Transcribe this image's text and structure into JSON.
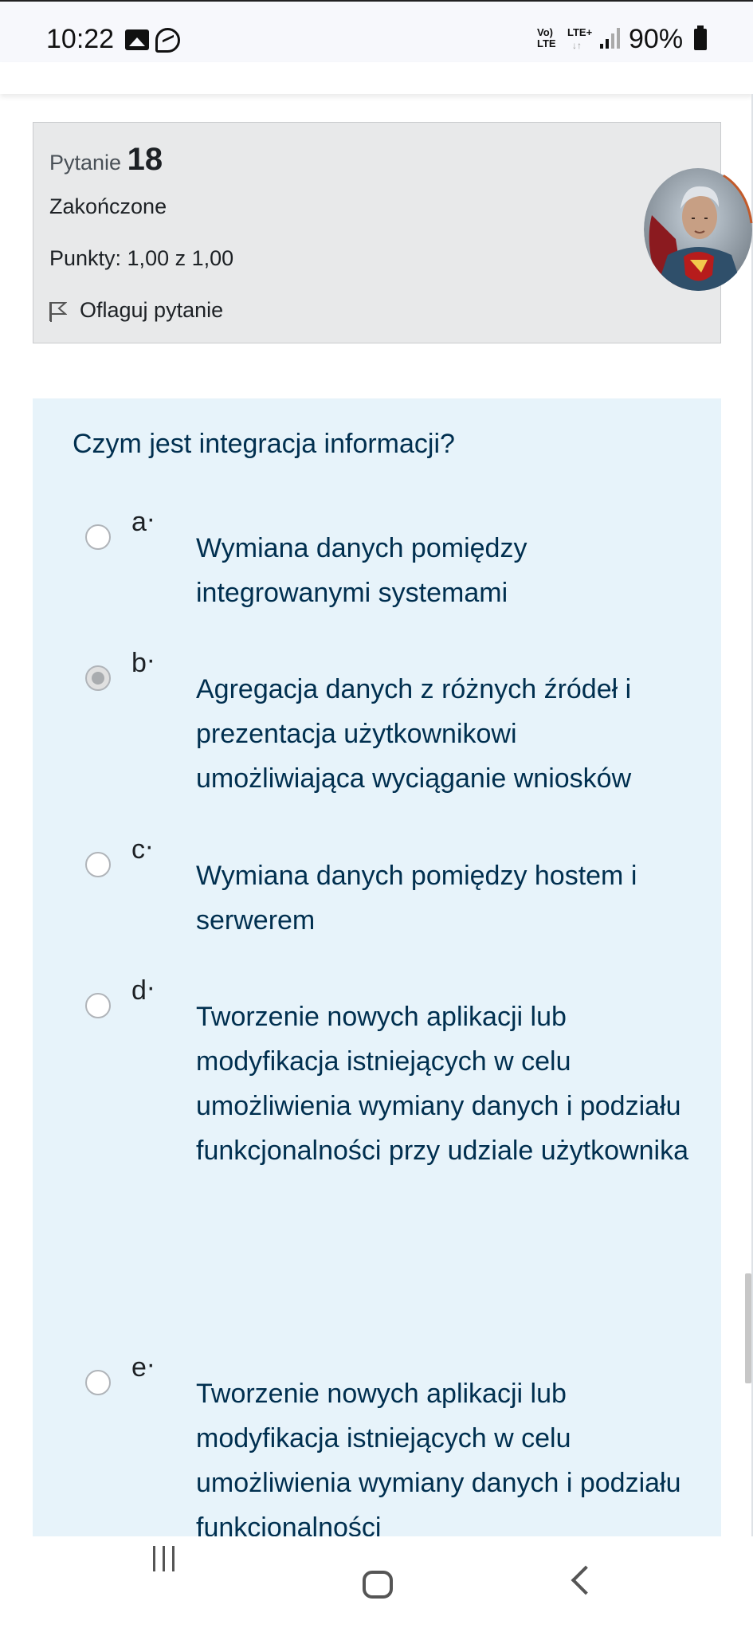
{
  "status_bar": {
    "time": "10:22",
    "icons": [
      "gallery-icon",
      "messenger-icon"
    ],
    "network_top": "Vo)",
    "network_bottom": "LTE",
    "lte_plus": "LTE+",
    "arrows": "↓↑",
    "battery": "90%"
  },
  "question_info": {
    "label": "Pytanie",
    "number": "18",
    "state": "Zakończone",
    "grade": "Punkty: 1,00 z 1,00",
    "flag_label": "Oflaguj pytanie"
  },
  "question": {
    "text": "Czym jest integracja informacji?",
    "answers": [
      {
        "letter": "a",
        "text": "Wymiana danych pomiędzy integrowanymi systemami",
        "checked": false
      },
      {
        "letter": "b",
        "text": "Agregacja danych z różnych źródeł i prezentacja użytkownikowi umożliwiająca wyciąganie wniosków",
        "checked": true
      },
      {
        "letter": "c",
        "text": "Wymiana danych pomiędzy hostem i serwerem",
        "checked": false
      },
      {
        "letter": "d",
        "text": "Tworzenie nowych aplikacji lub modyfikacja istniejących w celu umożliwienia wymiany danych i podziału funkcjonalności przy udziale użytkownika",
        "checked": false
      },
      {
        "letter": "e",
        "text": "Tworzenie nowych aplikacji lub modyfikacja istniejących w celu umożliwienia wymiany danych i podziału funkcjonalności",
        "checked": false
      }
    ]
  },
  "nav_bar": {
    "icons": [
      "recent-apps-icon",
      "home-icon",
      "back-icon"
    ]
  },
  "colors": {
    "question_bg": "#e7f3fa",
    "info_bg": "#e8e9ea",
    "question_text": "#002f4f"
  }
}
